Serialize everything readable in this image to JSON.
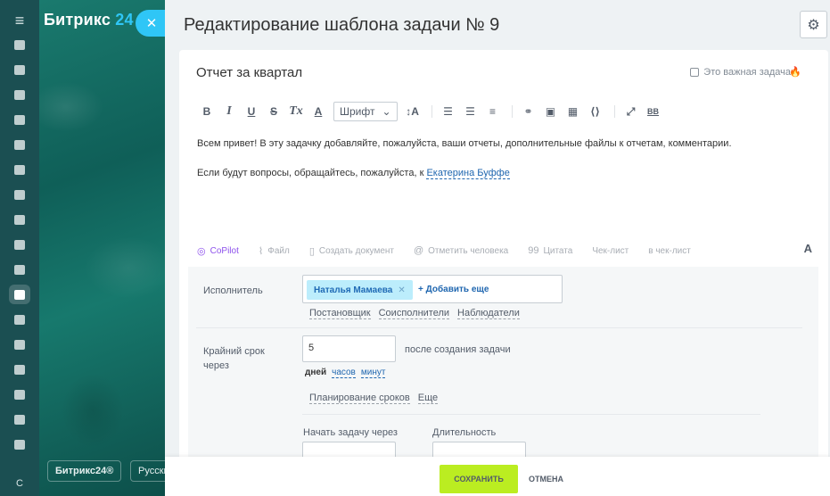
{
  "sidebar": {
    "brand_name": "Битрикс",
    "brand_num": "24",
    "menu_icon": "menu-icon",
    "close_icon": "close-icon",
    "lang_short": "С",
    "footer_brand": "Битрикс24®",
    "footer_lang": "Русский",
    "items": [
      {
        "icon": "rocket-icon"
      },
      {
        "icon": "mail-icon"
      },
      {
        "icon": "calendar-icon"
      },
      {
        "icon": "document-icon"
      },
      {
        "icon": "contact-card-icon"
      },
      {
        "icon": "chat-icon"
      },
      {
        "icon": "inbox-icon"
      },
      {
        "icon": "drive-icon"
      },
      {
        "icon": "team-icon"
      },
      {
        "icon": "edit-icon"
      },
      {
        "icon": "tasks-icon",
        "active": true
      },
      {
        "icon": "filter-icon"
      },
      {
        "icon": "store-icon"
      },
      {
        "icon": "cart-icon"
      },
      {
        "icon": "signature-icon"
      },
      {
        "icon": "inventory-icon"
      },
      {
        "icon": "box-icon"
      }
    ]
  },
  "header": {
    "title": "Редактирование шаблона задачи № 9",
    "settings_icon": "gear-icon"
  },
  "task": {
    "title": "Отчет за квартал",
    "important_label": "Это важная задача",
    "body_line1": "Всем привет! В эту задачку добавляйте, пожалуйста, ваши отчеты, дополнительные файлы к отчетам, комментарии.",
    "body_line2_prefix": "Если будут вопросы, обращайтесь, пожалуйста, к",
    "body_mention": "Екатерина Буффе"
  },
  "toolbar": {
    "bold": "B",
    "italic": "I",
    "underline": "U",
    "strike": "S",
    "clear": "Tx",
    "color": "A",
    "font_label": "Шрифт",
    "size": "↕A",
    "bbcode": "BB"
  },
  "actions": {
    "copilot": "CoPilot",
    "file": "Файл",
    "create_doc": "Создать документ",
    "mention": "Отметить человека",
    "quote": "Цитата",
    "checklist": "Чек-лист",
    "to_checklist": "в чек-лист",
    "format": "A"
  },
  "form": {
    "assignee_label": "Исполнитель",
    "assignee_name": "Наталья Мамаева",
    "add_more": "+ Добавить еще",
    "role_creator": "Постановщик",
    "role_coexec": "Соисполнители",
    "role_observers": "Наблюдатели",
    "deadline_label": "Крайний срок через",
    "deadline_value": "5",
    "after_text": "после создания задачи",
    "unit_days": "дней",
    "unit_hours": "часов",
    "unit_minutes": "минут",
    "planning": "Планирование сроков",
    "more": "Еще",
    "start_label": "Начать задачу через",
    "duration_label": "Длительность"
  },
  "footer": {
    "save": "СОХРАНИТЬ",
    "cancel": "ОТМЕНА"
  },
  "colors": {
    "accent": "#2fc6f6",
    "save": "#bbed21",
    "link": "#2067b0",
    "copilot": "#8e52ec"
  }
}
